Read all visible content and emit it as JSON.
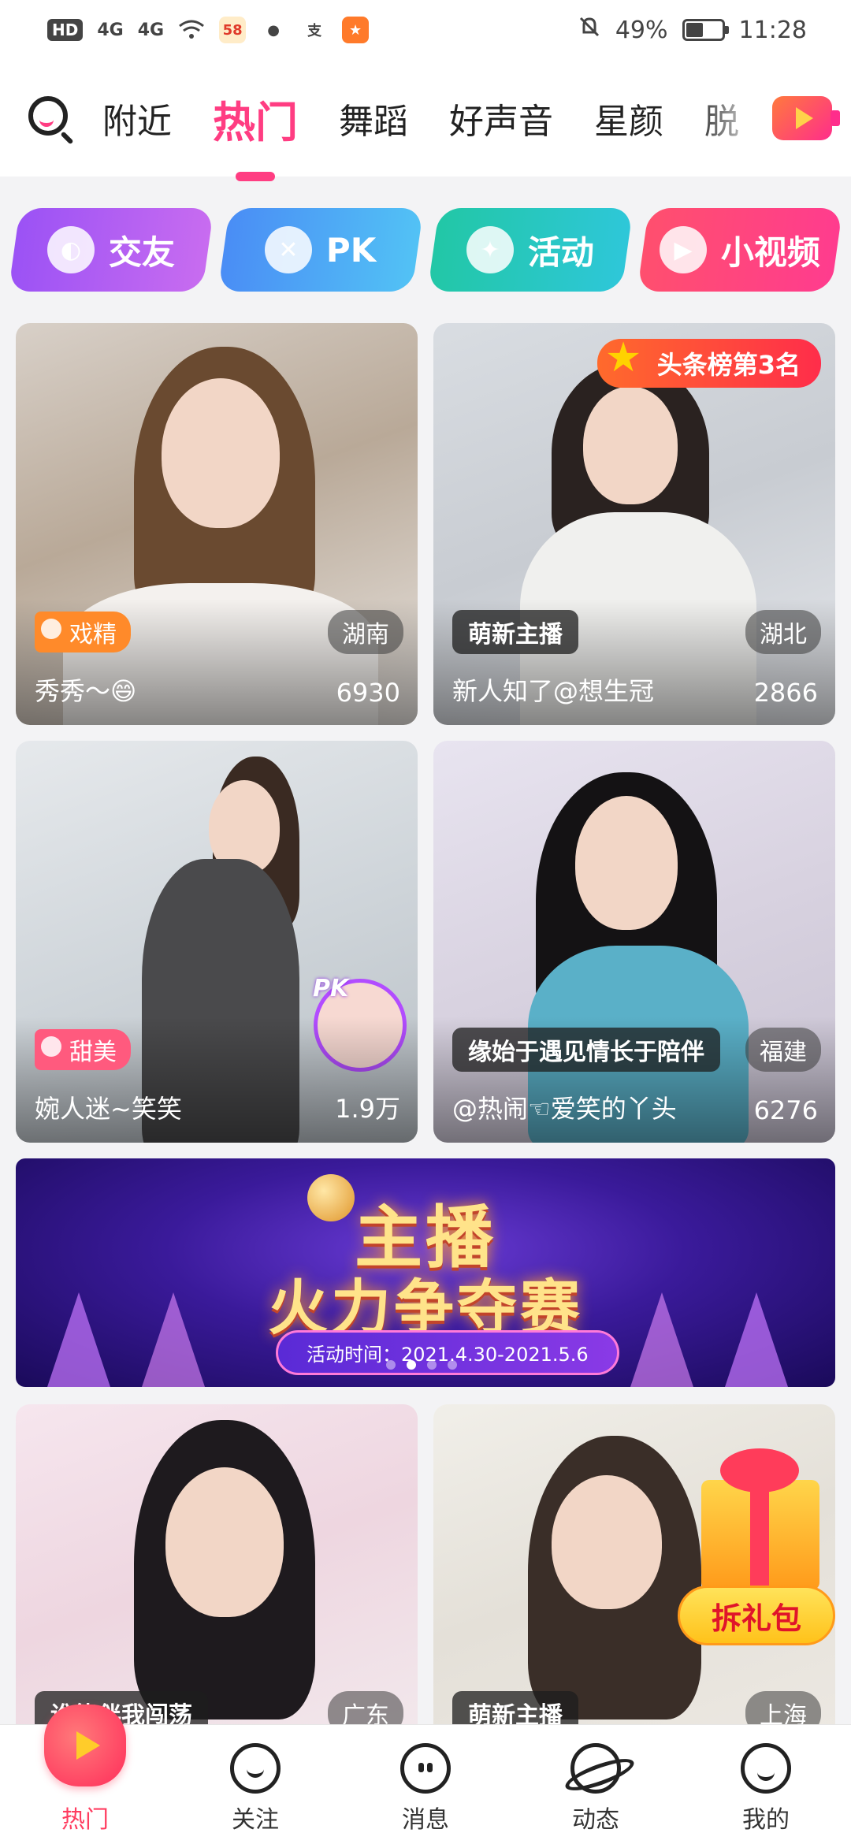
{
  "status": {
    "left_badge": "HD",
    "sig1": "4G",
    "sig2": "4G",
    "app_num": "58",
    "chat_glyph": "●",
    "pay_glyph": "支",
    "battery_text": "49%",
    "battery_level": 0.49,
    "time": "11:28"
  },
  "tabs": [
    {
      "label": "附近"
    },
    {
      "label": "热门"
    },
    {
      "label": "舞蹈"
    },
    {
      "label": "好声音"
    },
    {
      "label": "星颜"
    },
    {
      "label": "脱"
    }
  ],
  "quick_actions": [
    {
      "label": "交友",
      "icon": "ear-icon"
    },
    {
      "label": "PK",
      "icon": "swords-icon"
    },
    {
      "label": "活动",
      "icon": "party-icon"
    },
    {
      "label": "小视频",
      "icon": "video-icon"
    }
  ],
  "cards": [
    {
      "name": "秀秀～😄",
      "count": "6930",
      "region": "湖南",
      "tag": "戏精"
    },
    {
      "name": "新人知了@想生冠",
      "count": "2866",
      "region": "湖北",
      "label": "萌新主播",
      "rank": "头条榜第3名"
    },
    {
      "name": "婉人迷~笑笑",
      "count": "1.9万",
      "tag": "甜美",
      "pk": "PK"
    },
    {
      "name": "@热闹☜爱笑的丫头",
      "count": "6276",
      "region": "福建",
      "label": "缘始于遇见情长于陪伴"
    },
    {
      "region": "广东",
      "label": "谁能伴我闯荡"
    },
    {
      "region": "上海",
      "label": "萌新主播",
      "gift": "拆礼包"
    }
  ],
  "banner": {
    "title1": "主播",
    "title2": "火力争夺赛",
    "date": "活动时间：2021.4.30-2021.5.6",
    "active_dot": 1
  },
  "bottom_nav": [
    {
      "label": "热门"
    },
    {
      "label": "关注"
    },
    {
      "label": "消息"
    },
    {
      "label": "动态"
    },
    {
      "label": "我的"
    }
  ]
}
